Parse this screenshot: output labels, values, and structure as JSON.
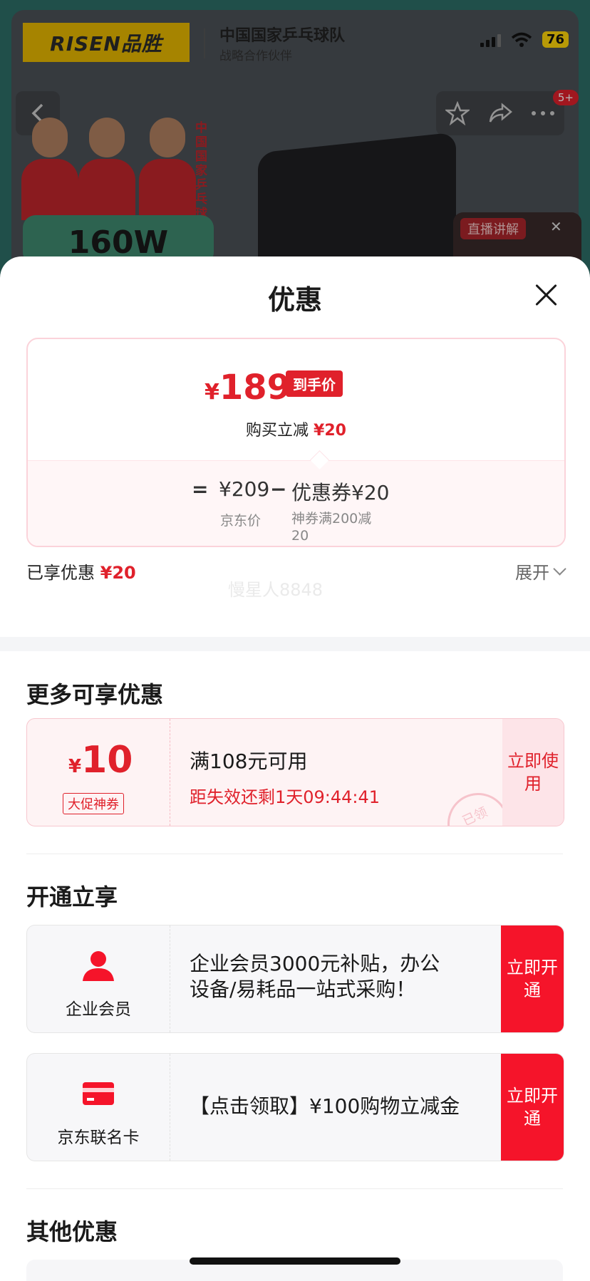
{
  "background": {
    "brand_logo": "RISEN品胜",
    "partner_title": "中国国家乒乓球队",
    "partner_subtitle": "战略合作伙伴",
    "battery": "76",
    "notification_badge": "5+",
    "vertical_team": "中国国家乒乓球队",
    "watt_label": "160W",
    "live_label": "直播讲解"
  },
  "sheet": {
    "title": "优惠",
    "price_card": {
      "yen": "¥",
      "final_price": "189",
      "final_price_tag": "到手价",
      "instant_label": "购买立减",
      "instant_amount": "¥20",
      "equals": "=",
      "jd_price": "¥209",
      "jd_price_label": "京东价",
      "minus": "−",
      "coupon_value": "优惠券¥20",
      "coupon_desc": "神券满200减20"
    },
    "enjoyed_label": "已享优惠",
    "enjoyed_amount": "¥20",
    "watermark": "慢星人8848",
    "expand_label": "展开"
  },
  "more_offers": {
    "title": "更多可享优惠",
    "coupon": {
      "yen": "¥",
      "amount": "10",
      "tag": "大促神券",
      "condition": "满108元可用",
      "countdown": "距失效还剩1天09:44:41",
      "stamp": "已领",
      "action": "立即使用"
    }
  },
  "open_enjoy": {
    "title": "开通立享",
    "items": [
      {
        "label": "企业会员",
        "desc_line1": "企业会员3000元补贴，办公",
        "desc_line2": "设备/易耗品一站式采购！",
        "action": "立即开通"
      },
      {
        "label": "京东联名卡",
        "desc_line1": "【点击领取】¥100购物立减金",
        "desc_line2": "",
        "action": "立即开通"
      }
    ]
  },
  "other_offers": {
    "title": "其他优惠"
  },
  "colors": {
    "accent_red": "#e0212b",
    "button_red": "#f5142a",
    "card_pink": "#fef3f4"
  }
}
